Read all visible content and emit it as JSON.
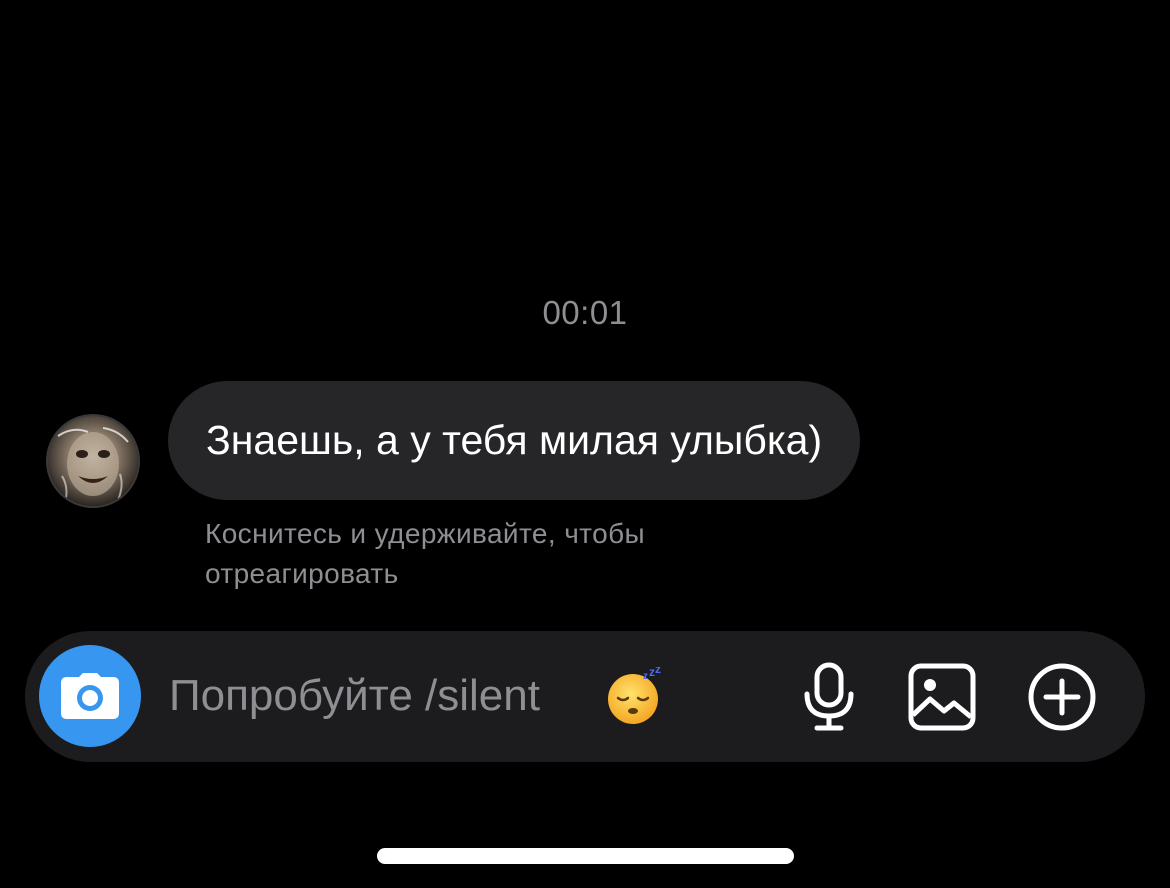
{
  "chat": {
    "timestamp": "00:01",
    "message": {
      "text": "Знаешь, а у тебя милая улыбка)"
    },
    "reaction_hint": "Коснитесь и удерживайте, чтобы отреагировать"
  },
  "composer": {
    "placeholder": "Попробуйте /silent",
    "placeholder_emoji": "sleeping-face",
    "camera_icon": "camera-icon",
    "mic_icon": "microphone-icon",
    "gallery_icon": "gallery-icon",
    "plus_icon": "plus-circle-icon"
  },
  "colors": {
    "background": "#000000",
    "bubble": "#262628",
    "composer": "#1c1c1e",
    "accent": "#3797f0",
    "secondary_text": "#8e8e93"
  }
}
